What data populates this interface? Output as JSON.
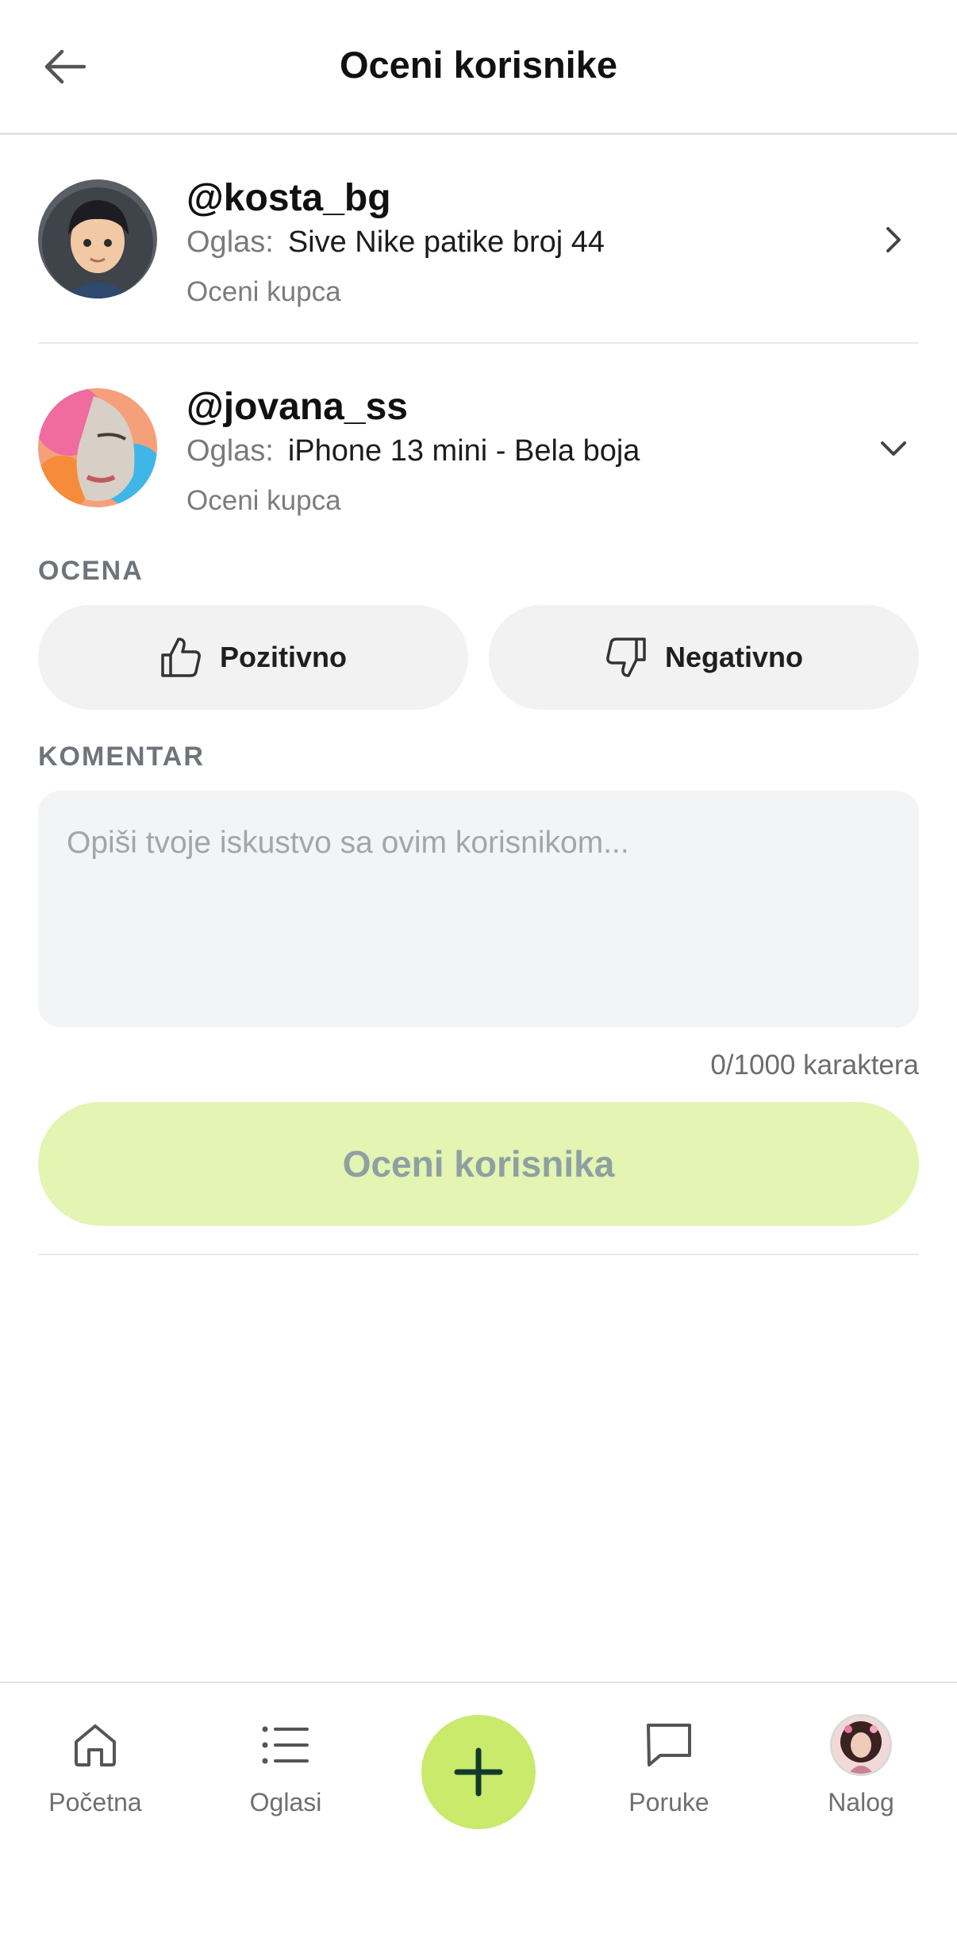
{
  "header": {
    "title": "Oceni korisnike",
    "back_icon": "arrow-left-icon"
  },
  "users": [
    {
      "username": "@kosta_bg",
      "ad_label": "Oglas:",
      "ad_title": "Sive Nike patike broj 44",
      "subtitle": "Oceni kupca",
      "chevron": "chevron-right-icon"
    },
    {
      "username": "@jovana_ss",
      "ad_label": "Oglas:",
      "ad_title": "iPhone 13 mini - Bela boja",
      "subtitle": "Oceni kupca",
      "chevron": "chevron-down-icon"
    }
  ],
  "rating": {
    "section_label": "OCENA",
    "positive_label": "Pozitivno",
    "negative_label": "Negativno"
  },
  "comment": {
    "section_label": "KOMENTAR",
    "value": "",
    "placeholder": "Opiši tvoje iskustvo sa ovim korisnikom...",
    "char_count": "0/1000 karaktera"
  },
  "submit": {
    "label": "Oceni korisnika",
    "disabled": true
  },
  "tabbar": {
    "items": [
      {
        "label": "Početna",
        "icon": "home-icon"
      },
      {
        "label": "Oglasi",
        "icon": "list-icon"
      },
      {
        "label": "",
        "icon": "plus-icon"
      },
      {
        "label": "Poruke",
        "icon": "chat-bubble-icon"
      },
      {
        "label": "Nalog",
        "icon": "profile-avatar"
      }
    ]
  },
  "colors": {
    "accent_green": "#c9ea6b",
    "submit_disabled_bg": "#e3f4b3",
    "submit_disabled_text": "#8ea0a2",
    "muted_text": "#7a7a7a"
  }
}
